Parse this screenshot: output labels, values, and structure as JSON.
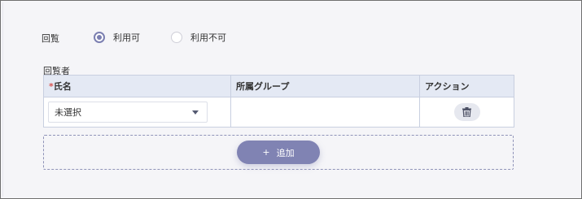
{
  "review": {
    "label": "回覧",
    "options": [
      {
        "label": "利用可",
        "checked": true
      },
      {
        "label": "利用不可",
        "checked": false
      }
    ]
  },
  "viewers": {
    "label": "回覧者",
    "columns": {
      "required_mark": "*",
      "name": "氏名",
      "group": "所属グループ",
      "action": "アクション"
    },
    "rows": [
      {
        "name_select": "未選択",
        "group": "",
        "action_icon": "trash-icon"
      }
    ],
    "add_button": {
      "icon": "+",
      "label": "追加"
    }
  },
  "colors": {
    "accent": "#7b7fb1",
    "header_bg": "#e4e9f4",
    "required": "#d9534f"
  }
}
